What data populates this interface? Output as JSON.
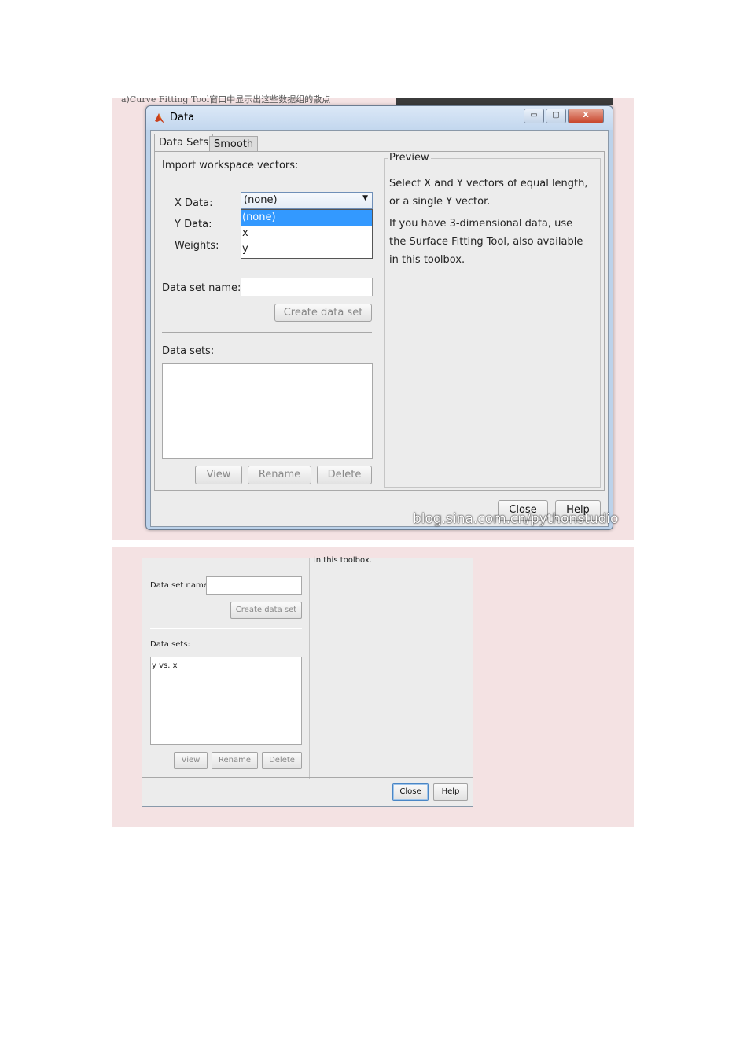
{
  "caption": "a)Curve Fitting Tool窗口中显示出这些数据组的散点",
  "window": {
    "title": "Data",
    "controls": {
      "minimize": "▭",
      "maximize": "▢",
      "close": "X"
    }
  },
  "tabs": [
    {
      "label": "Data Sets",
      "active": true
    },
    {
      "label": "Smooth",
      "active": false
    }
  ],
  "import_section": {
    "heading": "Import workspace vectors:",
    "x_label": "X Data:",
    "y_label": "Y Data:",
    "weights_label": "Weights:",
    "x_selected": "(none)",
    "dropdown_options": [
      "(none)",
      "x",
      "y"
    ],
    "dataset_name_label": "Data set name:",
    "dataset_name_value": "",
    "create_button": "Create data set"
  },
  "datasets_section": {
    "heading": "Data sets:",
    "items_top": [],
    "items_bottom": [
      "y vs. x"
    ],
    "view_button": "View",
    "rename_button": "Rename",
    "delete_button": "Delete"
  },
  "preview": {
    "title": "Preview",
    "line1": "Select X and Y vectors of equal length,",
    "line2": "or a single Y vector.",
    "line3": "If you have 3-dimensional data, use",
    "line4": "the Surface Fitting Tool, also available",
    "line5": "in this toolbox."
  },
  "footer": {
    "close_button": "Close",
    "help_button": "Help"
  },
  "watermark": "blog.sina.com.cn/pythonstudio",
  "bottom_crop": {
    "preview_tail": "in this toolbox."
  },
  "colors": {
    "panel_bg": "#f4e2e3",
    "selection": "#3399ff",
    "window_frame": "#bcd2ea"
  }
}
